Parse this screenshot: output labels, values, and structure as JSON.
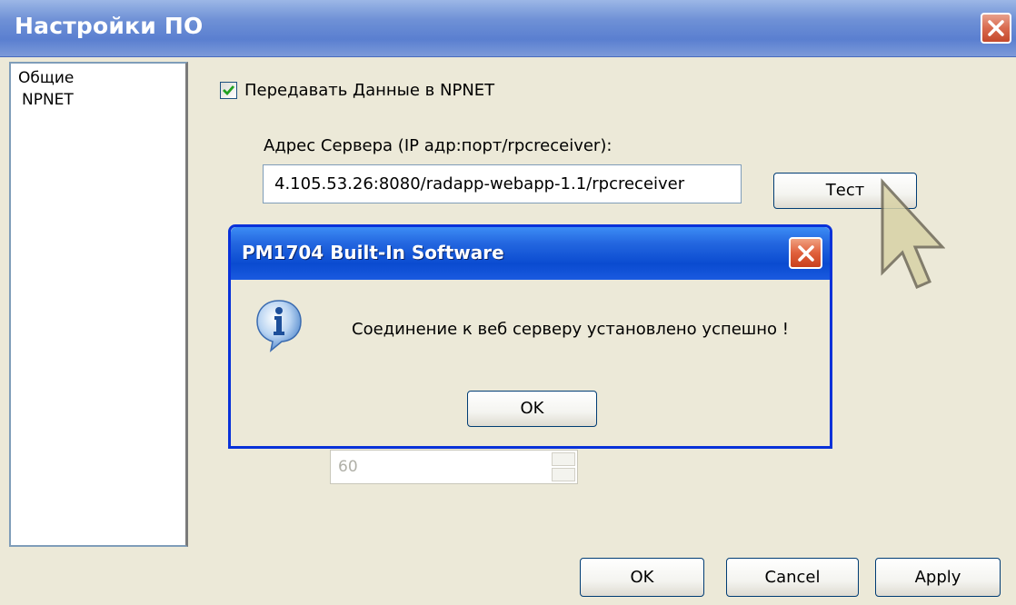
{
  "window": {
    "title": "Настройки ПО"
  },
  "nav": {
    "items": [
      "Общие",
      "NPNET"
    ]
  },
  "settings": {
    "send_checkbox_label": "Передавать Данные в NPNET",
    "send_checked": true,
    "server_label": "Адрес Сервера (IP адр:порт/rpcreceiver):",
    "server_value": "4.105.53.26:8080/radapp-webapp-1.1/rpcreceiver",
    "test_button": "Тест",
    "interval_value": "60"
  },
  "footer": {
    "ok": "OK",
    "cancel": "Cancel",
    "apply": "Apply"
  },
  "dialog": {
    "title": "PM1704 Built-In Software",
    "message": "Соединение к веб серверу установлено успешно !",
    "ok": "OK",
    "icon": "info-icon"
  },
  "colors": {
    "titlebar": "#6f91d6",
    "dialog_titlebar": "#0a4bd0",
    "close_button": "#d96a4f",
    "window_bg": "#ece9d8"
  }
}
